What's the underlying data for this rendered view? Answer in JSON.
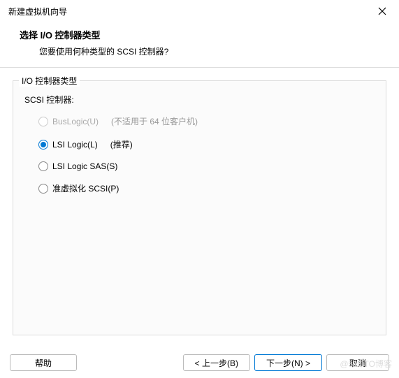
{
  "window": {
    "title": "新建虚拟机向导"
  },
  "header": {
    "title": "选择 I/O 控制器类型",
    "subtitle": "您要使用何种类型的 SCSI 控制器?"
  },
  "fieldset": {
    "legend": "I/O 控制器类型",
    "group_label": "SCSI 控制器:",
    "options": [
      {
        "label": "BusLogic(U)",
        "hint": "(不适用于 64 位客户机)",
        "disabled": true,
        "selected": false
      },
      {
        "label": "LSI Logic(L)",
        "hint": "(推荐)",
        "disabled": false,
        "selected": true
      },
      {
        "label": "LSI Logic SAS(S)",
        "hint": "",
        "disabled": false,
        "selected": false
      },
      {
        "label": "准虚拟化 SCSI(P)",
        "hint": "",
        "disabled": false,
        "selected": false
      }
    ]
  },
  "footer": {
    "help": "帮助",
    "back": "< 上一步(B)",
    "next": "下一步(N) >",
    "cancel": "取消"
  },
  "watermark": "@51CTO博客"
}
